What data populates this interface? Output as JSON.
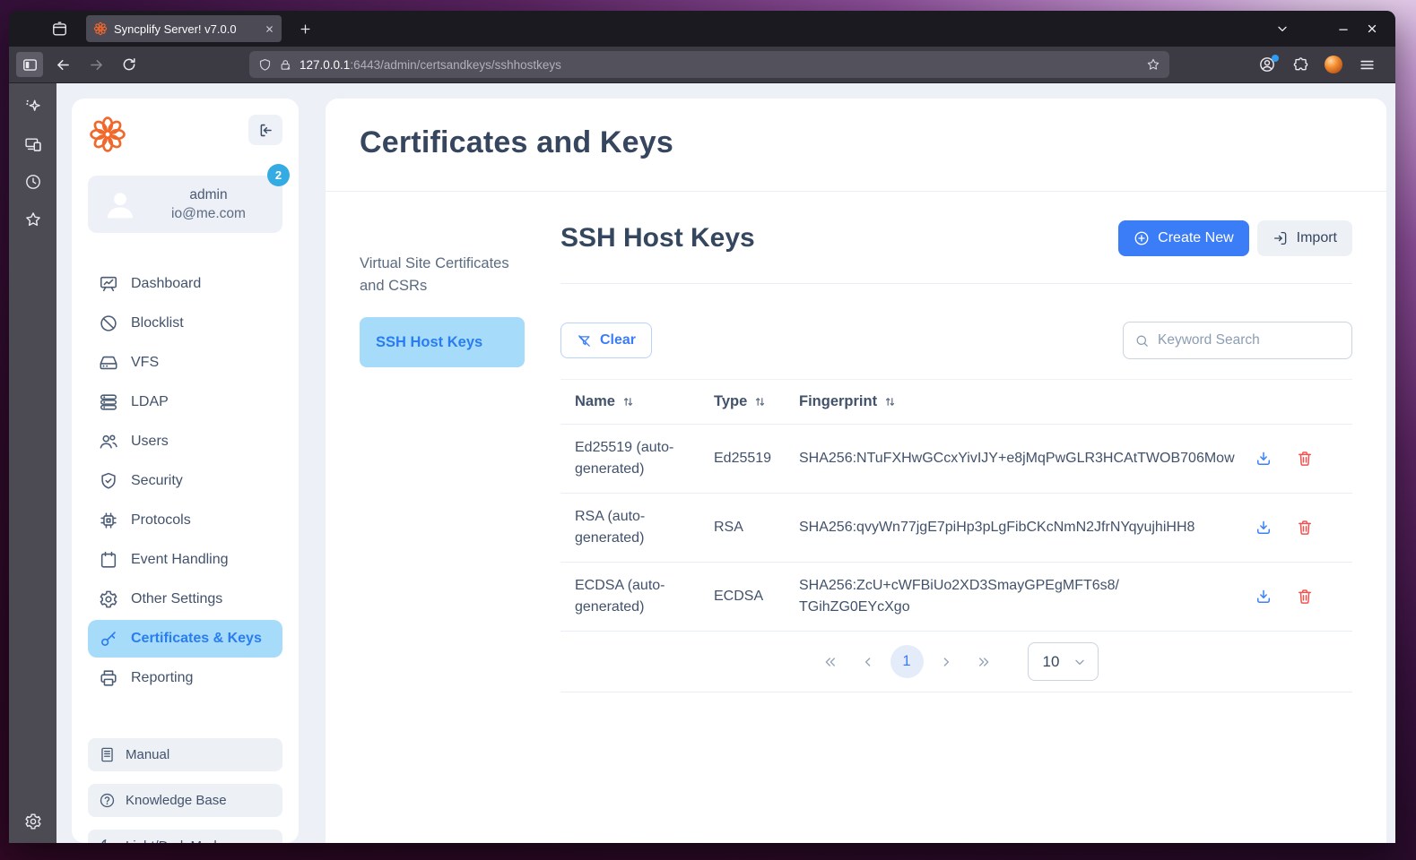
{
  "browser": {
    "tab_title": "Syncplify Server! v7.0.0",
    "url_host": "127.0.0.1",
    "url_path": ":6443/admin/certsandkeys/sshhostkeys"
  },
  "sidebar": {
    "user": {
      "name": "admin",
      "email": "io@me.com",
      "badge": "2"
    },
    "items": [
      {
        "label": "Dashboard"
      },
      {
        "label": "Blocklist"
      },
      {
        "label": "VFS"
      },
      {
        "label": "LDAP"
      },
      {
        "label": "Users"
      },
      {
        "label": "Security"
      },
      {
        "label": "Protocols"
      },
      {
        "label": "Event Handling"
      },
      {
        "label": "Other Settings"
      },
      {
        "label": "Certificates & Keys",
        "active": true
      },
      {
        "label": "Reporting"
      }
    ],
    "footer": [
      {
        "label": "Manual"
      },
      {
        "label": "Knowledge Base"
      },
      {
        "label": "Light/Dark Mode"
      }
    ]
  },
  "main": {
    "page_title": "Certificates and Keys",
    "subnav": [
      {
        "label": "Virtual Site Certificates and CSRs"
      },
      {
        "label": "SSH Host Keys",
        "active": true
      }
    ],
    "section_title": "SSH Host Keys",
    "buttons": {
      "create": "Create New",
      "import": "Import",
      "clear": "Clear"
    },
    "search_placeholder": "Keyword Search",
    "table": {
      "columns": [
        "Name",
        "Type",
        "Fingerprint"
      ],
      "rows": [
        {
          "name": "Ed25519 (auto-generated)",
          "type": "Ed25519",
          "fp_lines": [
            "SHA256:NTuFXHwGCcxYivIJY+e8jMqPwGLR3HCAtTWOB706Mow"
          ]
        },
        {
          "name": "RSA (auto-generated)",
          "type": "RSA",
          "fp_lines": [
            "SHA256:qvyWn77jgE7piHp3pLgFibCKcNmN2JfrNYqyujhiHH8"
          ]
        },
        {
          "name": "ECDSA (auto-generated)",
          "type": "ECDSA",
          "fp_lines": [
            "SHA256:ZcU+cWFBiUo2XD3SmayGPEgMFT6s8/",
            "TGihZG0EYcXgo"
          ]
        }
      ]
    },
    "pagination": {
      "page": "1",
      "page_size": "10"
    }
  },
  "colors": {
    "accent_blue": "#3b7cf7",
    "selected_bg": "#a6dbfa",
    "badge_blue": "#35abe4",
    "danger_red": "#ef5350",
    "logo_orange": "#f2672a"
  }
}
